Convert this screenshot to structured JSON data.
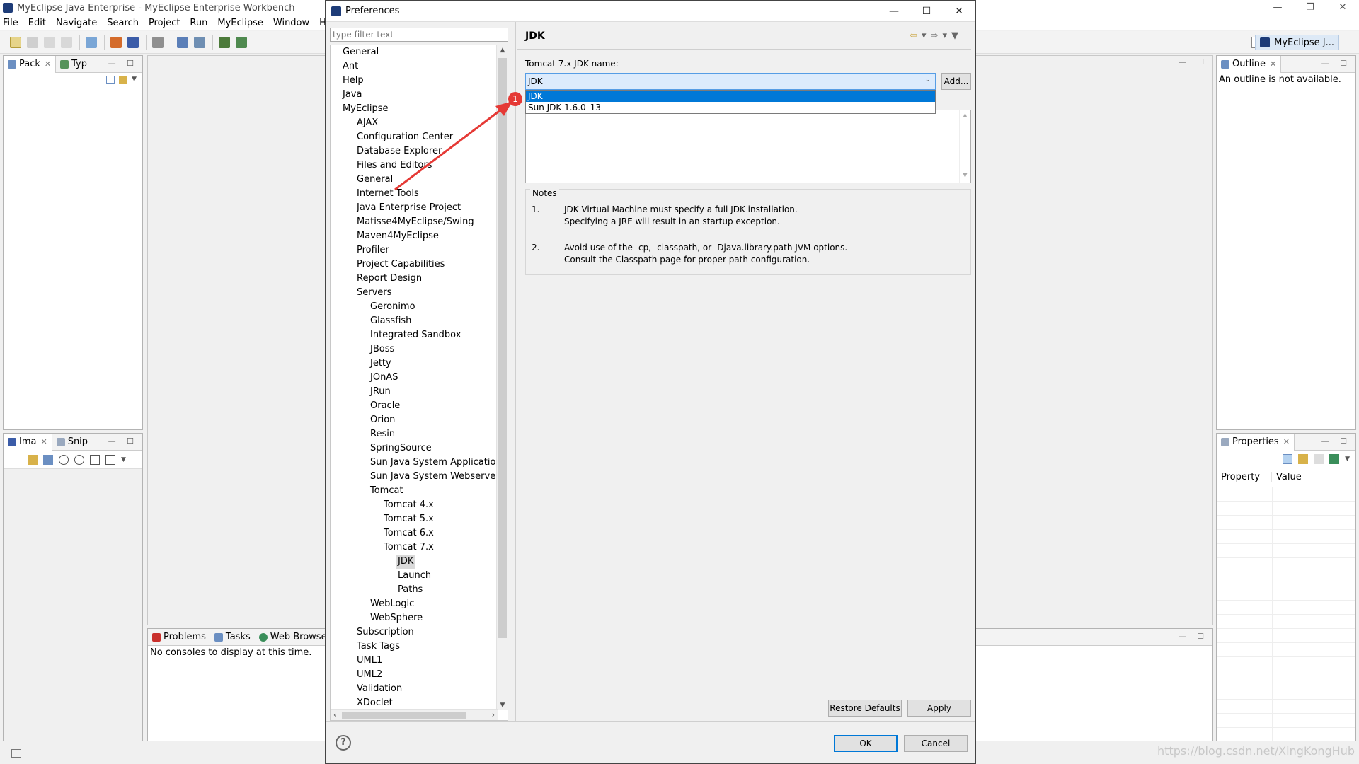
{
  "window": {
    "title": "MyEclipse Java Enterprise - MyEclipse Enterprise Workbench",
    "controls": {
      "minimize": "—",
      "restore": "❐",
      "close": "✕"
    }
  },
  "menubar": [
    "File",
    "Edit",
    "Navigate",
    "Search",
    "Project",
    "Run",
    "MyEclipse",
    "Window",
    "Help"
  ],
  "perspective": {
    "label": "MyEclipse J..."
  },
  "left_top_panel": {
    "tabs": [
      {
        "label": "Pack",
        "closable": true
      },
      {
        "label": "Typ",
        "closable": false
      }
    ]
  },
  "left_bottom_panel": {
    "tabs": [
      {
        "label": "Ima",
        "closable": true
      },
      {
        "label": "Snip",
        "closable": false
      }
    ]
  },
  "console_panel": {
    "tabs": [
      "Problems",
      "Tasks",
      "Web Browser"
    ],
    "message": "No consoles to display at this time."
  },
  "outline_panel": {
    "tab": "Outline",
    "message": "An outline is not available."
  },
  "properties_panel": {
    "tab": "Properties",
    "columns": [
      "Property",
      "Value"
    ]
  },
  "dialog": {
    "title": "Preferences",
    "controls": {
      "minimize": "—",
      "maximize": "☐",
      "close": "✕"
    },
    "filter_placeholder": "type filter text",
    "tree": [
      {
        "label": "General",
        "level": 0
      },
      {
        "label": "Ant",
        "level": 0
      },
      {
        "label": "Help",
        "level": 0
      },
      {
        "label": "Java",
        "level": 0
      },
      {
        "label": "MyEclipse",
        "level": 0
      },
      {
        "label": "AJAX",
        "level": 1
      },
      {
        "label": "Configuration Center",
        "level": 1
      },
      {
        "label": "Database Explorer",
        "level": 1
      },
      {
        "label": "Files and Editors",
        "level": 1
      },
      {
        "label": "General",
        "level": 1
      },
      {
        "label": "Internet Tools",
        "level": 1
      },
      {
        "label": "Java Enterprise Project",
        "level": 1
      },
      {
        "label": "Matisse4MyEclipse/Swing",
        "level": 1
      },
      {
        "label": "Maven4MyEclipse",
        "level": 1
      },
      {
        "label": "Profiler",
        "level": 1
      },
      {
        "label": "Project Capabilities",
        "level": 1
      },
      {
        "label": "Report Design",
        "level": 1
      },
      {
        "label": "Servers",
        "level": 1
      },
      {
        "label": "Geronimo",
        "level": 2
      },
      {
        "label": "Glassfish",
        "level": 2
      },
      {
        "label": "Integrated Sandbox",
        "level": 2
      },
      {
        "label": "JBoss",
        "level": 2
      },
      {
        "label": "Jetty",
        "level": 2
      },
      {
        "label": "JOnAS",
        "level": 2
      },
      {
        "label": "JRun",
        "level": 2
      },
      {
        "label": "Oracle",
        "level": 2
      },
      {
        "label": "Orion",
        "level": 2
      },
      {
        "label": "Resin",
        "level": 2
      },
      {
        "label": "SpringSource",
        "level": 2
      },
      {
        "label": "Sun Java System Application S",
        "level": 2
      },
      {
        "label": "Sun Java System Webserver",
        "level": 2
      },
      {
        "label": "Tomcat",
        "level": 2
      },
      {
        "label": "Tomcat  4.x",
        "level": 3
      },
      {
        "label": "Tomcat  5.x",
        "level": 3
      },
      {
        "label": "Tomcat  6.x",
        "level": 3
      },
      {
        "label": "Tomcat  7.x",
        "level": 3
      },
      {
        "label": "JDK",
        "level": 4,
        "selected": true
      },
      {
        "label": "Launch",
        "level": 4
      },
      {
        "label": "Paths",
        "level": 4
      },
      {
        "label": "WebLogic",
        "level": 2
      },
      {
        "label": "WebSphere",
        "level": 2
      },
      {
        "label": "Subscription",
        "level": 1
      },
      {
        "label": "Task Tags",
        "level": 1
      },
      {
        "label": "UML1",
        "level": 1
      },
      {
        "label": "UML2",
        "level": 1
      },
      {
        "label": "Validation",
        "level": 1
      },
      {
        "label": "XDoclet",
        "level": 1
      }
    ],
    "page": {
      "title": "JDK",
      "jdk_name_label": "Tomcat  7.x JDK name:",
      "jdk_combo_value": "JDK",
      "add_button": "Add...",
      "dropdown_options": [
        {
          "label": "JDK",
          "selected": true
        },
        {
          "label": "Sun JDK 1.6.0_13",
          "selected": false
        }
      ],
      "notes": {
        "title": "Notes",
        "items": [
          {
            "num": "1.",
            "lines": [
              "JDK Virtual Machine must specify a full JDK installation.",
              "Specifying a JRE will result in an startup exception."
            ]
          },
          {
            "num": "2.",
            "lines": [
              "Avoid use of the -cp, -classpath, or -Djava.library.path JVM options.",
              "Consult the Classpath page for proper path configuration."
            ]
          }
        ]
      },
      "restore_defaults_button": "Restore Defaults",
      "apply_button": "Apply"
    },
    "ok_button": "OK",
    "cancel_button": "Cancel",
    "help_icon": "?"
  },
  "annotation": {
    "badge": "1",
    "color": "#e53935"
  },
  "watermark": "https://blog.csdn.net/XingKongHub"
}
